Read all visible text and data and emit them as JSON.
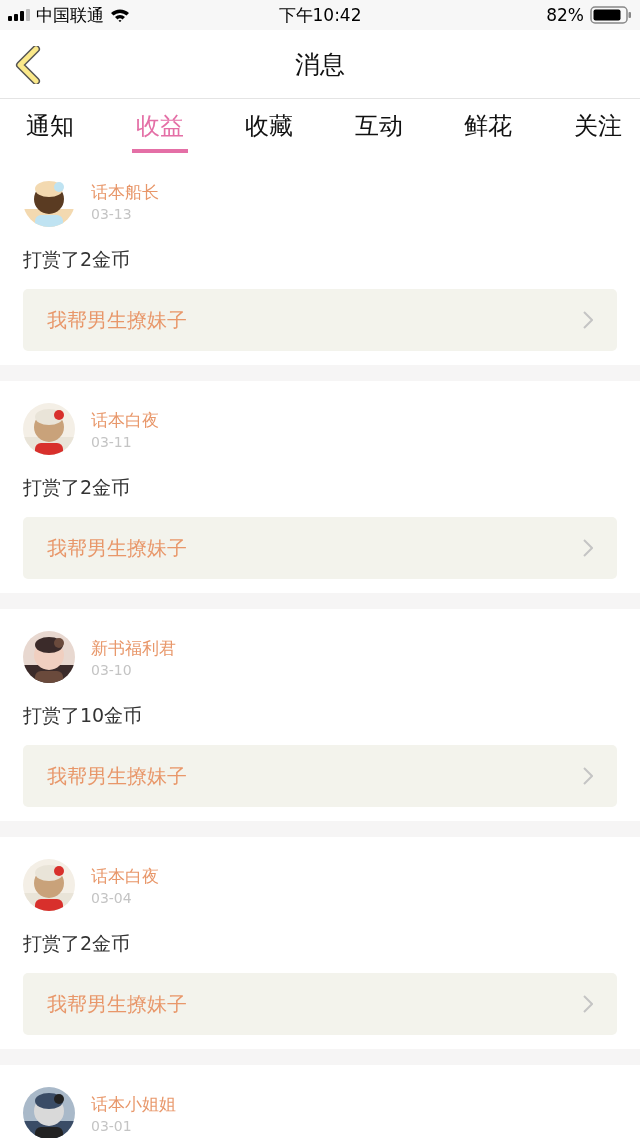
{
  "status_bar": {
    "carrier": "中国联通",
    "time": "下午10:42",
    "battery": "82%"
  },
  "nav": {
    "title": "消息"
  },
  "tabs": [
    {
      "label": "通知",
      "selected": false
    },
    {
      "label": "收益",
      "selected": true
    },
    {
      "label": "收藏",
      "selected": false
    },
    {
      "label": "互动",
      "selected": false
    },
    {
      "label": "鲜花",
      "selected": false
    },
    {
      "label": "关注",
      "selected": false
    }
  ],
  "messages": [
    {
      "name": "话本船长",
      "date": "03-13",
      "text": "打赏了2金币",
      "book": "我帮男生撩妹子"
    },
    {
      "name": "话本白夜",
      "date": "03-11",
      "text": "打赏了2金币",
      "book": "我帮男生撩妹子"
    },
    {
      "name": "新书福利君",
      "date": "03-10",
      "text": "打赏了10金币",
      "book": "我帮男生撩妹子"
    },
    {
      "name": "话本白夜",
      "date": "03-04",
      "text": "打赏了2金币",
      "book": "我帮男生撩妹子"
    },
    {
      "name": "话本小姐姐",
      "date": "03-01"
    }
  ]
}
